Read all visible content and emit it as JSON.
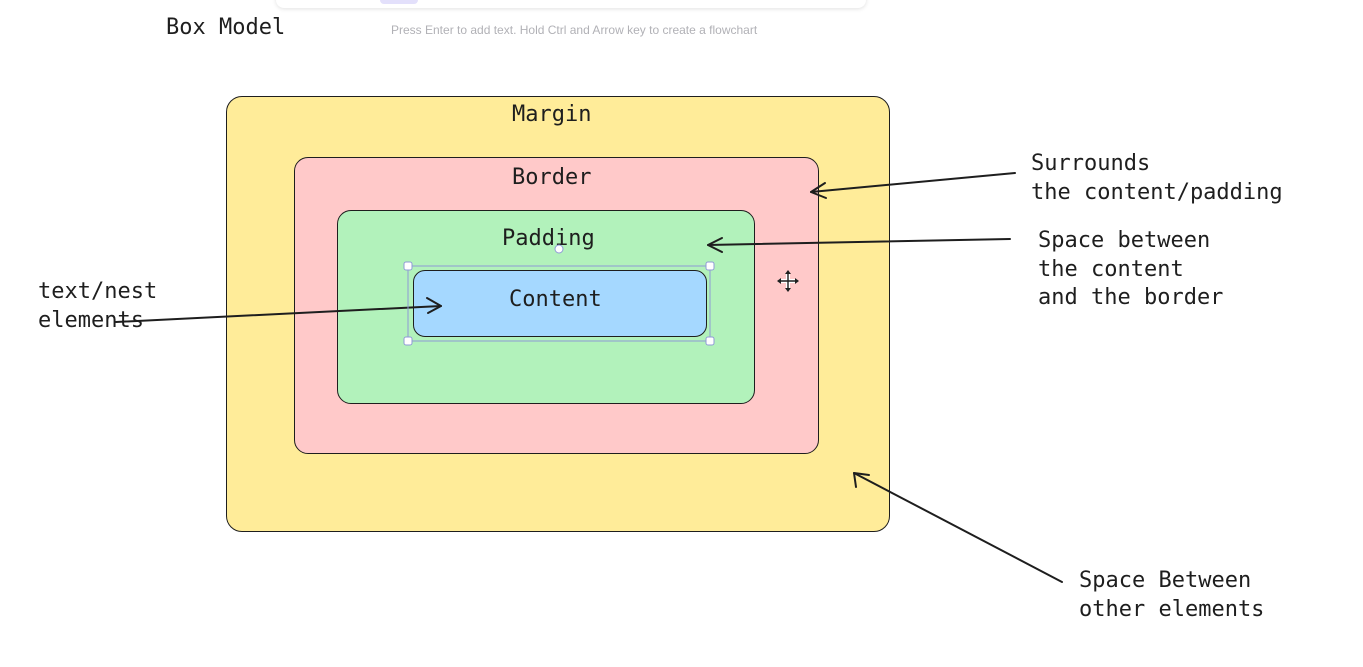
{
  "canvas": {
    "hint": "Press Enter to add text. Hold Ctrl and Arrow key to create a flowchart"
  },
  "diagram": {
    "title": "Box Model",
    "layers": {
      "margin": {
        "label": "Margin",
        "color": "#ffec99"
      },
      "border": {
        "label": "Border",
        "color": "#ffc9c9"
      },
      "padding": {
        "label": "Padding",
        "color": "#b2f2bb"
      },
      "content": {
        "label": "Content",
        "color": "#a5d8ff"
      }
    },
    "annotations": {
      "border": "Surrounds\nthe content/padding",
      "padding": "Space between\nthe content\nand the border",
      "margin": "Space Between\nother elements",
      "content": "text/nest\nelements"
    },
    "colors": {
      "stroke": "#1e1e1e",
      "selection": "#8f9ad6"
    },
    "icons": {
      "cursor": "move-cursor-icon"
    }
  }
}
